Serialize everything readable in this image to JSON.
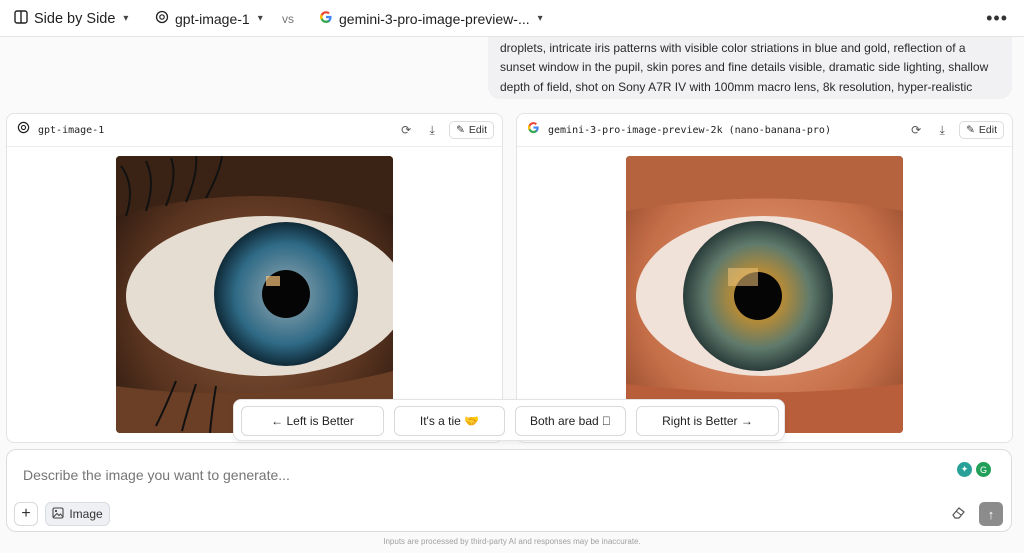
{
  "topbar": {
    "mode_label": "Side by Side",
    "model_left": "gpt-image-1",
    "vs": "vs",
    "model_right": "gemini-3-pro-image-preview-...",
    "more": "•••"
  },
  "prompt": {
    "text": "droplets, intricate iris patterns with visible color striations in blue and gold, reflection of a sunset window in the pupil, skin pores and fine details visible, dramatic side lighting, shallow depth of field, shot on Sony A7R IV with 100mm macro lens, 8k resolution, hyper-realistic"
  },
  "panels": {
    "left": {
      "model": "gpt-image-1",
      "edit": "Edit"
    },
    "right": {
      "model": "gemini-3-pro-image-preview-2k (nano-banana-pro)",
      "edit": "Edit"
    }
  },
  "vote": {
    "left_better": "← Left is Better",
    "tie": "It's a tie 🤝",
    "both_bad": "Both are bad ⃠",
    "right_better": "Right is Better →"
  },
  "input": {
    "placeholder": "Describe the image you want to generate...",
    "image_button": "Image"
  },
  "footer": {
    "note": "Inputs are processed by third-party AI and responses may be inaccurate."
  },
  "colors": {
    "accent_google_blue": "#4285F4",
    "google_red": "#EA4335",
    "google_yellow": "#FBBC05",
    "google_green": "#34A853"
  }
}
